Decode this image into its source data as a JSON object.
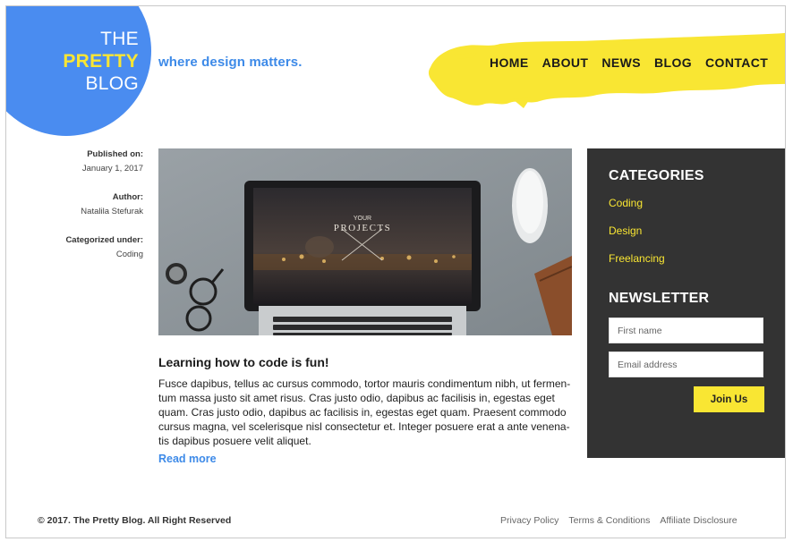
{
  "brand": {
    "line1": "THE",
    "line2": "PRETTY",
    "line3": "BLOG",
    "tagline": "where design matters.",
    "circle_color": "#4a8cf0",
    "accent_yellow": "#f9e633"
  },
  "nav": {
    "items": [
      "HOME",
      "ABOUT",
      "NEWS",
      "BLOG",
      "CONTACT"
    ]
  },
  "meta": {
    "published_label": "Published on:",
    "published_value": "January 1, 2017",
    "author_label": "Author:",
    "author_value": "Natalila Stefurak",
    "category_label": "Categorized under:",
    "category_value": "Coding"
  },
  "post": {
    "image_text_1": "YOUR",
    "image_text_2": "PROJECTS",
    "title": "Learning how to code is fun!",
    "body": "Fusce dapibus, tellus ac cursus commodo, tortor mauris condimentum nibh, ut fermen­tum massa justo sit amet risus. Cras justo odio, dapibus ac facilisis in, egestas eget quam. Cras justo odio, dapibus ac facilisis in, egestas eget quam. Praesent commodo cursus magna, vel scelerisque nisl consectetur et. Integer posuere erat a ante venena­tis dapibus posuere velit aliquet.",
    "read_more": "Read more"
  },
  "sidebar": {
    "categories_title": "CATEGORIES",
    "categories": [
      "Coding",
      "Design",
      "Freelancing"
    ],
    "newsletter_title": "NEWSLETTER",
    "first_name_placeholder": "First name",
    "email_placeholder": "Email address",
    "join_label": "Join Us",
    "bg_color": "#333333"
  },
  "footer": {
    "copyright": "© 2017. The Pretty Blog. All Right Reserved",
    "links": [
      "Privacy Policy",
      "Terms & Conditions",
      "Affiliate Disclosure"
    ]
  }
}
